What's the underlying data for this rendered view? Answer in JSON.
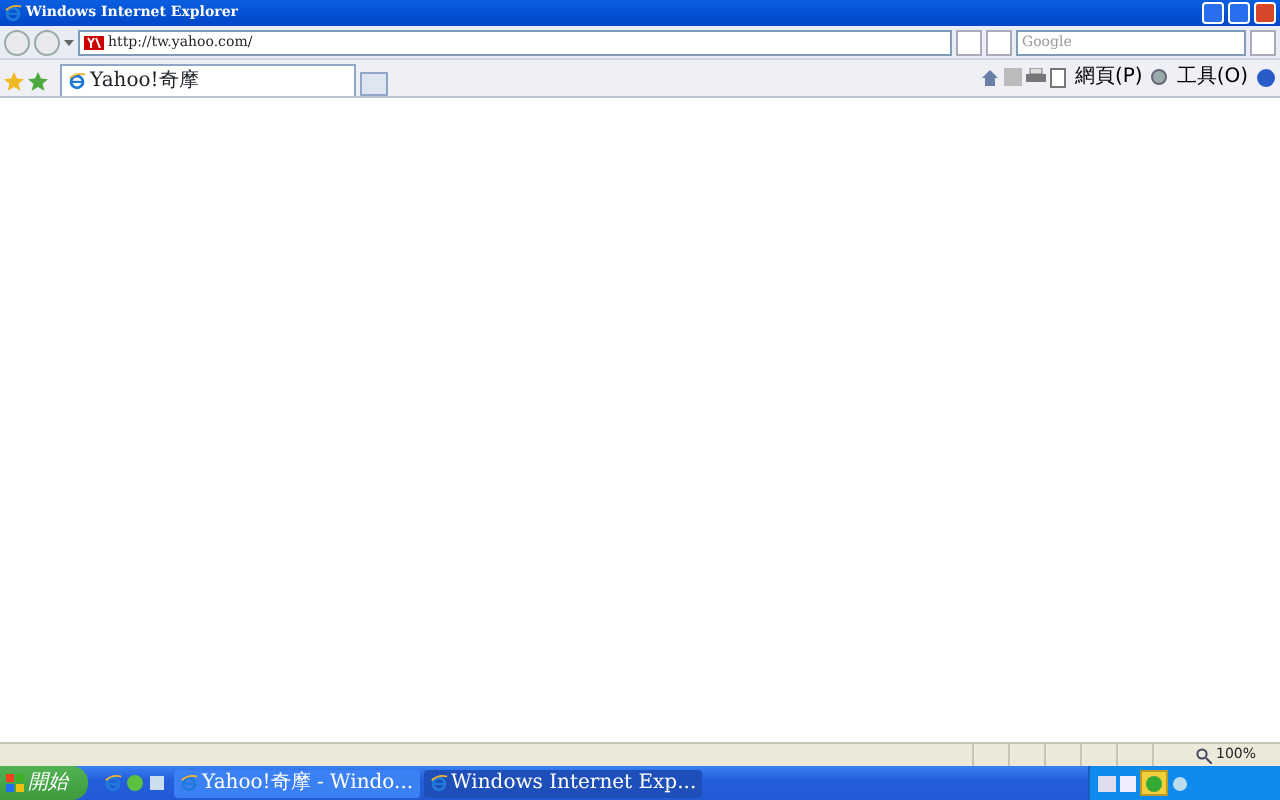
{
  "window": {
    "title": "Windows Internet Explorer"
  },
  "address_bar": {
    "url": "http://tw.yahoo.com/",
    "search_placeholder": "Google"
  },
  "tabs": [
    {
      "label": "Yahoo!奇摩",
      "selected": true
    }
  ],
  "command_bar": {
    "page_menu": "網頁(P)",
    "tools_menu": "工具(O)"
  },
  "status_bar": {
    "zoom": "100%"
  },
  "taskbar": {
    "start": "開始",
    "buttons": [
      {
        "label": "Yahoo!奇摩 - Windo...",
        "selected": false
      },
      {
        "label": "Windows Internet Exp...",
        "selected": true
      }
    ]
  }
}
